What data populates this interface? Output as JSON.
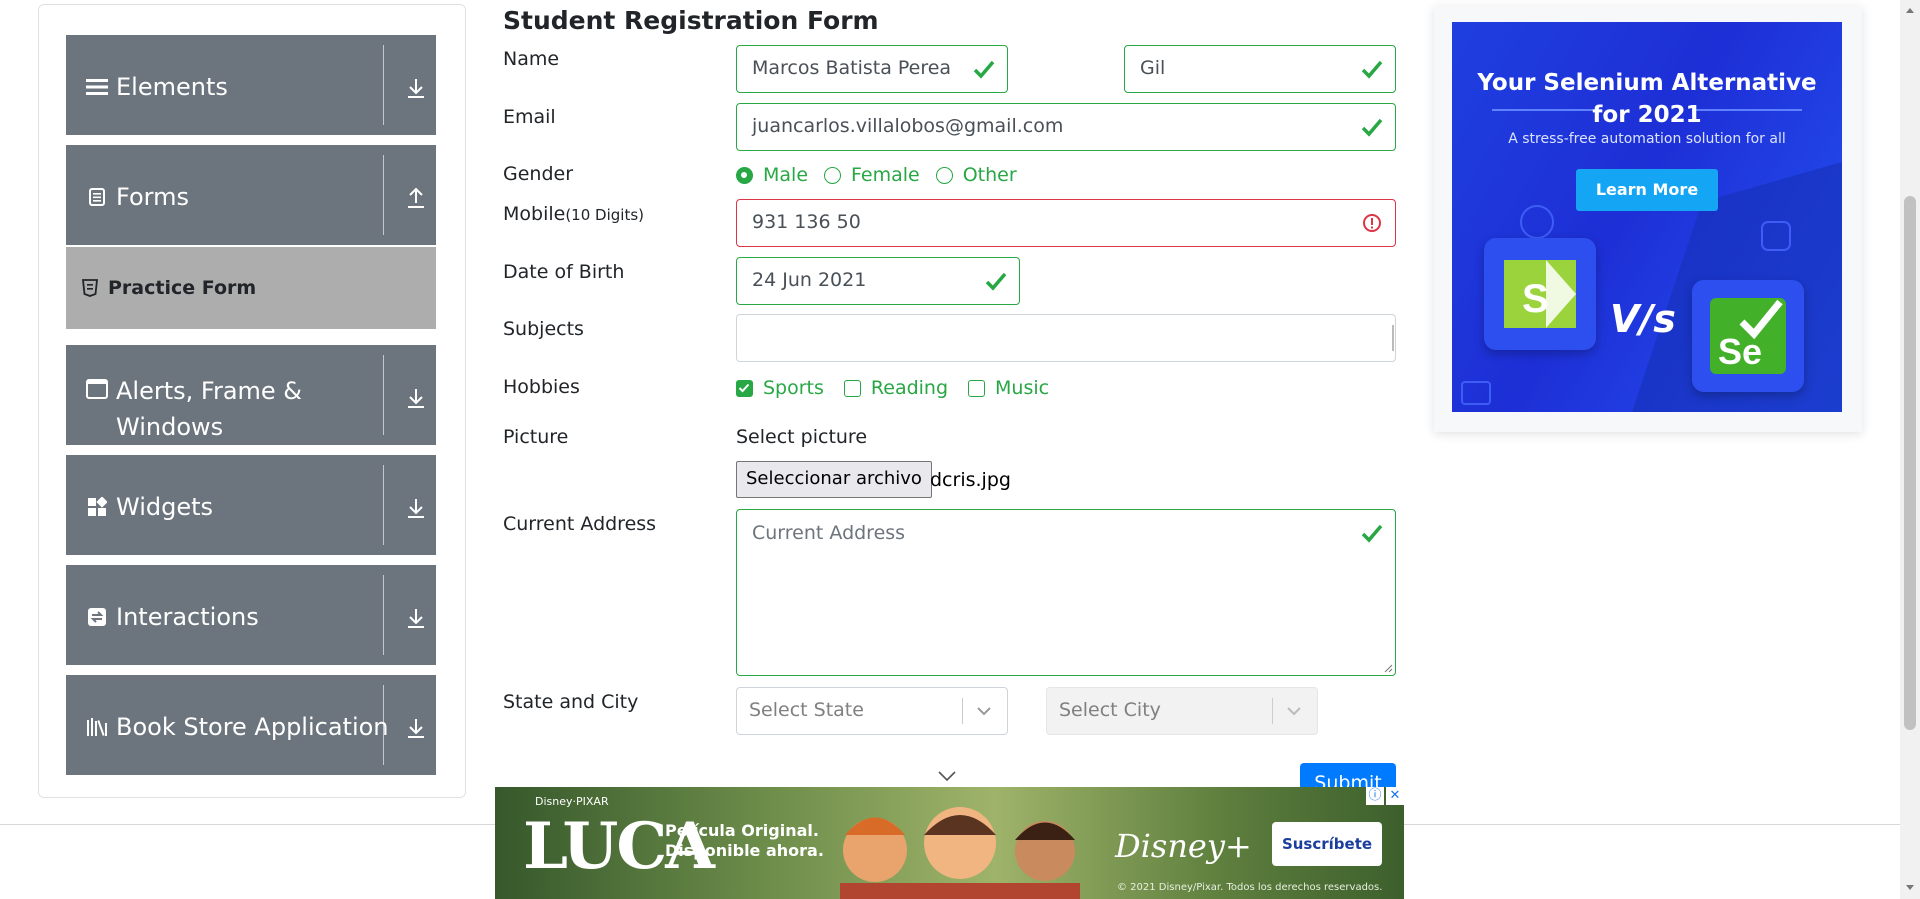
{
  "sidebar": {
    "groups": [
      {
        "label": "Elements",
        "icon": "hamburger-icon",
        "arrow": "download-arrow-icon"
      },
      {
        "label": "Forms",
        "icon": "form-document-icon",
        "arrow": "upload-arrow-icon"
      },
      {
        "label": "Alerts, Frame & Windows",
        "label_line1": "Alerts, Frame &",
        "label_line2": "Windows",
        "icon": "window-icon",
        "arrow": "download-arrow-icon"
      },
      {
        "label": "Widgets",
        "icon": "widgets-grid-icon",
        "arrow": "download-arrow-icon"
      },
      {
        "label": "Interactions",
        "icon": "interactions-icon",
        "arrow": "download-arrow-icon"
      },
      {
        "label": "Book Store Application",
        "icon": "books-icon",
        "arrow": "download-arrow-icon"
      }
    ],
    "active_item": {
      "label": "Practice Form",
      "icon": "html5-shield-icon"
    }
  },
  "form": {
    "title": "Student Registration Form",
    "labels": {
      "name": "Name",
      "email": "Email",
      "gender": "Gender",
      "mobile": "Mobile",
      "mobile_hint": "(10 Digits)",
      "dob": "Date of Birth",
      "subjects": "Subjects",
      "hobbies": "Hobbies",
      "picture": "Picture",
      "address": "Current Address",
      "state_city": "State and City"
    },
    "first_name": "Marcos Batista Perea",
    "last_name": "Gil",
    "email": "juancarlos.villalobos@gmail.com",
    "gender_options": [
      "Male",
      "Female",
      "Other"
    ],
    "gender_selected": "Male",
    "mobile": "931 136 50",
    "dob": "24 Jun 2021",
    "subjects": "",
    "hobbies": [
      {
        "label": "Sports",
        "checked": true
      },
      {
        "label": "Reading",
        "checked": false
      },
      {
        "label": "Music",
        "checked": false
      }
    ],
    "picture_label": "Select picture",
    "file_button": "Seleccionar archivo",
    "file_name": "dcris.jpg",
    "address_placeholder": "Current Address",
    "state_placeholder": "Select State",
    "city_placeholder": "Select City",
    "submit_label": "Submit",
    "colors": {
      "valid": "#28a745",
      "invalid": "#dc3545",
      "primary": "#007bff"
    }
  },
  "ad_right": {
    "headline_line1": "Your Selenium Alternative",
    "headline_line2": "for 2021",
    "subtitle": "A stress-free automation solution for all",
    "cta": "Learn More",
    "vs": "V/s",
    "logo_left": "S",
    "logo_right": "Se"
  },
  "ad_bottom": {
    "brand_top": "Disney·PIXAR",
    "title": "LUCA",
    "tagline_line1": "Película Original.",
    "tagline_line2": "Disponible ahora.",
    "service": "Disney+",
    "cta": "Suscríbete",
    "copyright": "© 2021 Disney/Pixar. Todos los derechos reservados."
  }
}
